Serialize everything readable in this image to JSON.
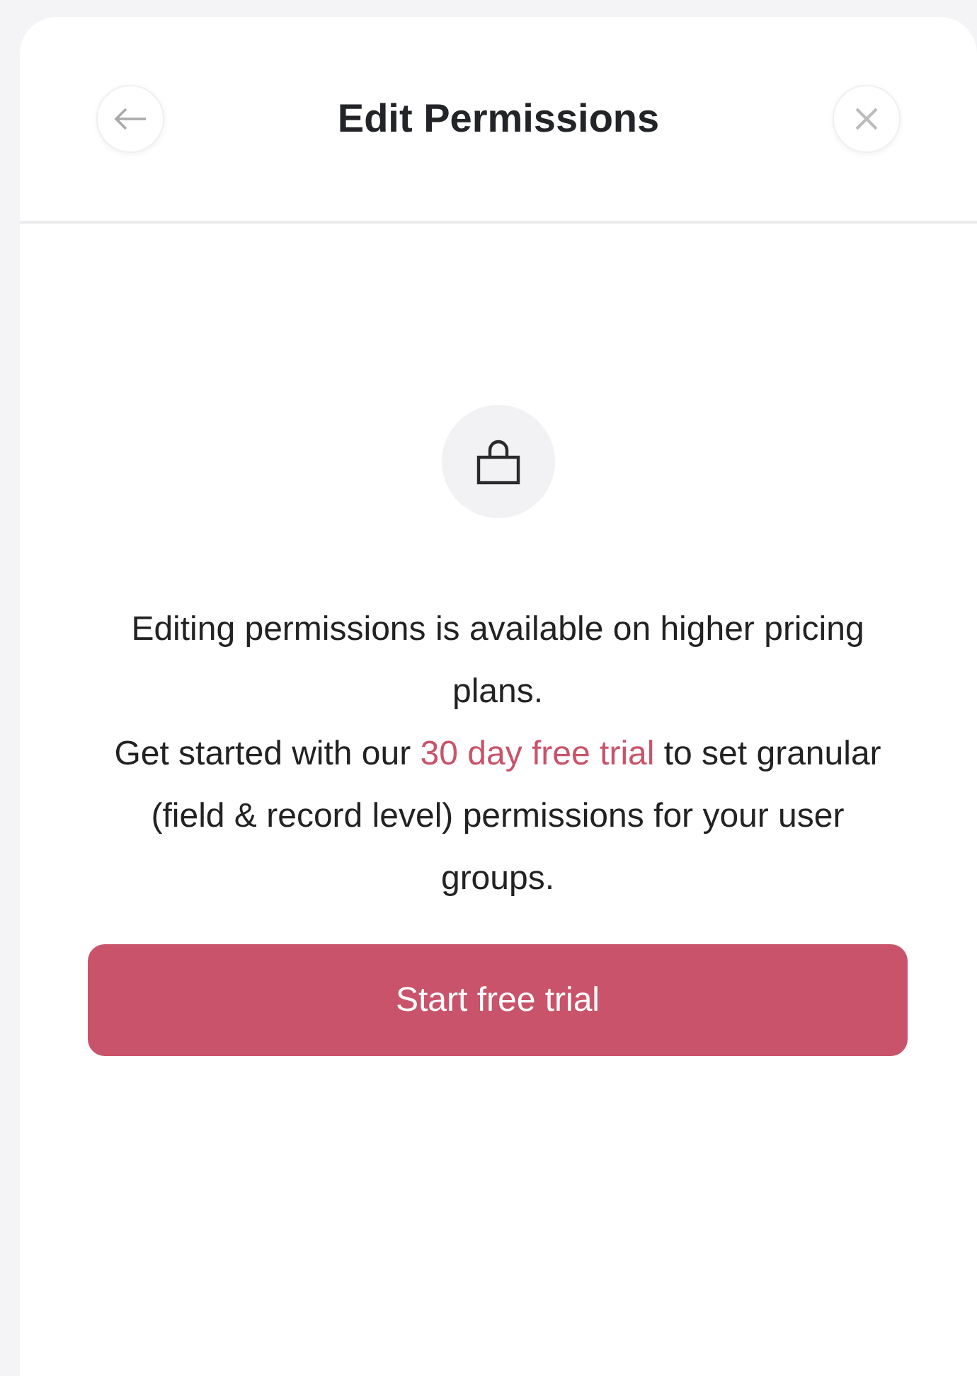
{
  "dialog": {
    "title": "Edit Permissions"
  },
  "message": {
    "lines": [
      "Editing permissions is available on higher pricing plans."
    ],
    "cta_sentence": {
      "before": "Get started with our ",
      "link": "30 day free trial",
      "after": " to set granular (field & record level) permissions for your user groups."
    }
  },
  "primary_button": {
    "label": "Start free trial"
  }
}
